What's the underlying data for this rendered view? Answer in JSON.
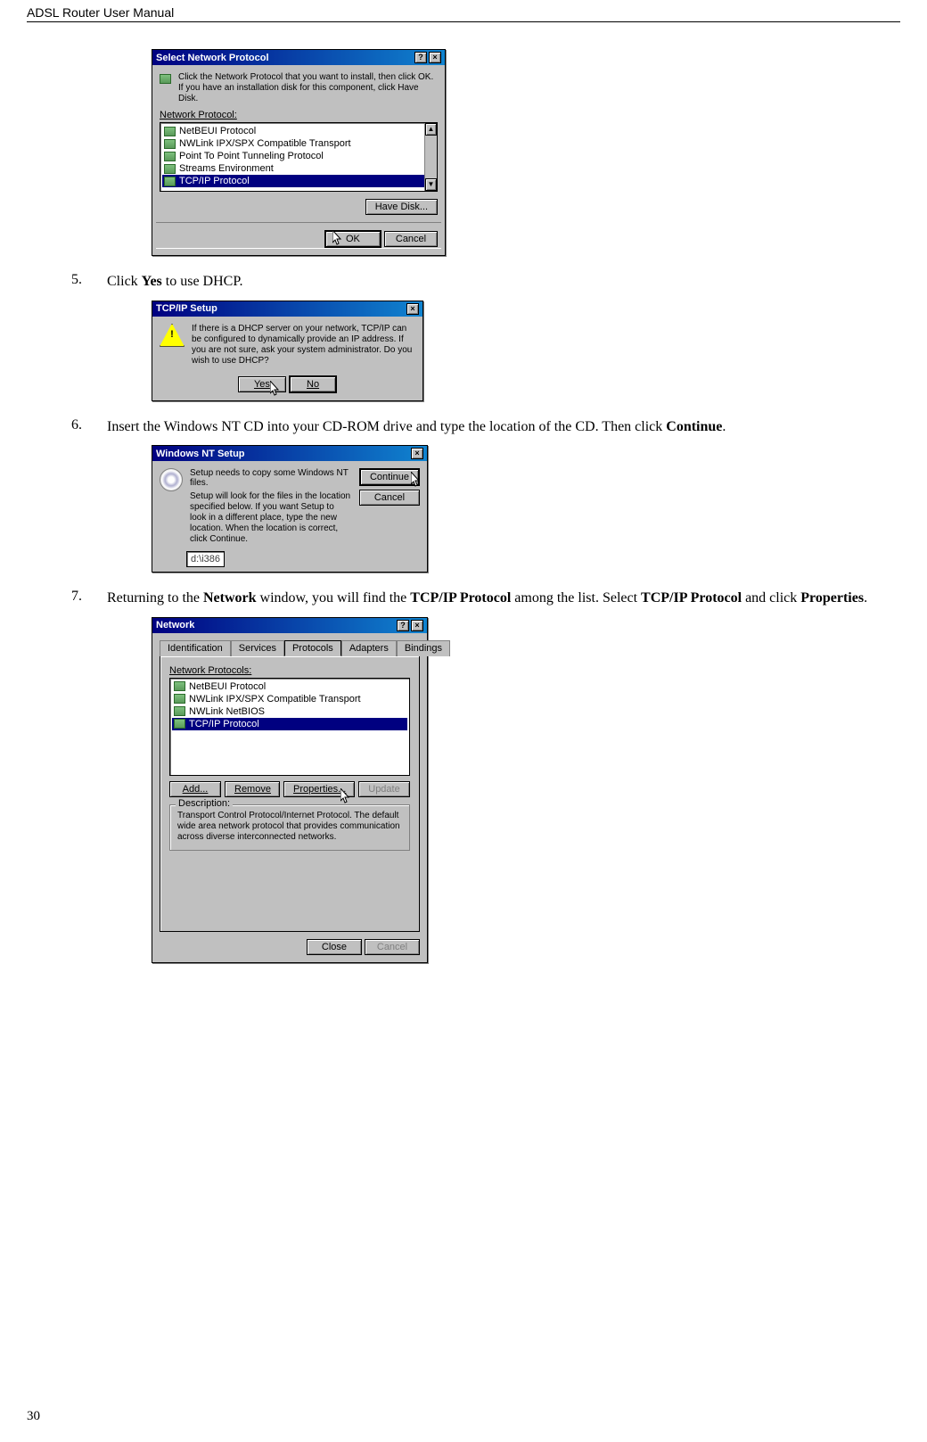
{
  "header": {
    "title": "ADSL Router User Manual"
  },
  "page_number": "30",
  "steps": {
    "s5": {
      "num": "5.",
      "text_before": "Click ",
      "bold1": "Yes",
      "text_after": " to use DHCP."
    },
    "s6": {
      "num": "6.",
      "text_before": "Insert the Windows NT CD into your CD-ROM drive and type the location of the CD. Then click ",
      "bold1": "Continue",
      "text_after": "."
    },
    "s7": {
      "num": "7.",
      "frag1": "Returning to the ",
      "b1": "Network",
      "frag2": " window, you will find the ",
      "b2": "TCP/IP Protocol",
      "frag3": " among the list. Select ",
      "b3": "TCP/IP Protocol",
      "frag4": " and click ",
      "b4": "Properties",
      "frag5": "."
    }
  },
  "dlg_select_protocol": {
    "title": "Select Network Protocol",
    "instruction": "Click the Network Protocol that you want to install, then click OK. If you have an installation disk for this component, click Have Disk.",
    "list_label": "Network Protocol:",
    "items": [
      "NetBEUI Protocol",
      "NWLink IPX/SPX Compatible Transport",
      "Point To Point Tunneling Protocol",
      "Streams Environment",
      "TCP/IP Protocol"
    ],
    "btn_have_disk": "Have Disk...",
    "btn_ok": "OK",
    "btn_cancel": "Cancel"
  },
  "dlg_tcpip_setup": {
    "title": "TCP/IP Setup",
    "message": "If there is a DHCP server on your network, TCP/IP can be configured to dynamically provide an IP address. If you are not sure, ask your system administrator. Do you wish to use DHCP?",
    "btn_yes": "Yes",
    "btn_no": "No"
  },
  "dlg_nt_setup": {
    "title": "Windows NT Setup",
    "line1": "Setup needs to copy some Windows NT files.",
    "line2": "Setup will look for the files in the location specified below. If you want Setup to look in a different place, type the new location. When the location is correct, click Continue.",
    "input_value": "d:\\i386",
    "btn_continue": "Continue",
    "btn_cancel": "Cancel"
  },
  "dlg_network": {
    "title": "Network",
    "tabs": [
      "Identification",
      "Services",
      "Protocols",
      "Adapters",
      "Bindings"
    ],
    "active_tab": "Protocols",
    "list_label": "Network Protocols:",
    "items": [
      "NetBEUI Protocol",
      "NWLink IPX/SPX Compatible Transport",
      "NWLink NetBIOS",
      "TCP/IP Protocol"
    ],
    "btn_add": "Add...",
    "btn_remove": "Remove",
    "btn_properties": "Properties...",
    "btn_update": "Update",
    "desc_label": "Description:",
    "desc_text": "Transport Control Protocol/Internet Protocol. The default wide area network protocol that provides communication across diverse interconnected networks.",
    "btn_close": "Close",
    "btn_cancel": "Cancel"
  }
}
